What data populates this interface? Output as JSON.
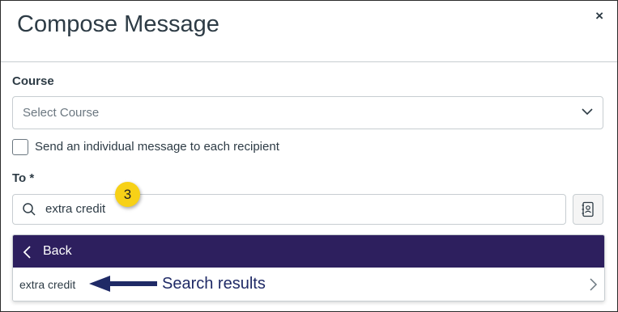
{
  "dialog": {
    "title": "Compose Message",
    "close_label": "×"
  },
  "course": {
    "label": "Course",
    "placeholder": "Select Course"
  },
  "individual": {
    "label": "Send an individual message to each recipient",
    "checked": false
  },
  "to": {
    "label": "To *",
    "search_value": "extra credit"
  },
  "step_badge": "3",
  "dropdown": {
    "back_label": "Back",
    "results": [
      {
        "label": "extra credit"
      }
    ]
  },
  "annotation": {
    "text": "Search results"
  },
  "colors": {
    "back_row_bg": "#2d1f5e",
    "badge_bg": "#f7d117",
    "annotation": "#1f2a66"
  },
  "icons": [
    "close-icon",
    "chevron-down-icon",
    "search-icon",
    "address-book-icon",
    "chevron-left-icon",
    "chevron-right-icon",
    "arrow-left-icon"
  ]
}
